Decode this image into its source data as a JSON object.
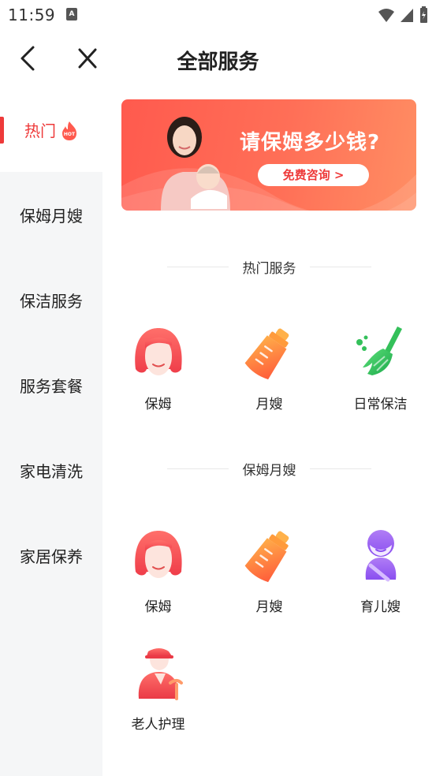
{
  "status_bar": {
    "time": "11:59",
    "notification_glyph": "A"
  },
  "header": {
    "title": "全部服务",
    "back_icon": "back-icon",
    "close_icon": "close-icon"
  },
  "sidebar": {
    "items": [
      {
        "label": "热门",
        "active": true,
        "badge": "HOT"
      },
      {
        "label": "保姆月嫂",
        "active": false
      },
      {
        "label": "保洁服务",
        "active": false
      },
      {
        "label": "服务套餐",
        "active": false
      },
      {
        "label": "家电清洗",
        "active": false
      },
      {
        "label": "家居保养",
        "active": false
      }
    ]
  },
  "banner": {
    "title": "请保姆多少钱?",
    "button_label": "免费咨询 >"
  },
  "sections": [
    {
      "title": "热门服务",
      "items": [
        {
          "label": "保姆",
          "icon": "nanny-icon"
        },
        {
          "label": "月嫂",
          "icon": "baby-bottle-icon"
        },
        {
          "label": "日常保洁",
          "icon": "broom-icon"
        }
      ]
    },
    {
      "title": "保姆月嫂",
      "items": [
        {
          "label": "保姆",
          "icon": "nanny-icon"
        },
        {
          "label": "月嫂",
          "icon": "baby-bottle-icon"
        },
        {
          "label": "育儿嫂",
          "icon": "childcare-icon"
        },
        {
          "label": "老人护理",
          "icon": "elderly-care-icon"
        }
      ]
    }
  ],
  "colors": {
    "accent": "#ee3a3a",
    "sidebar_bg": "#f5f6f7",
    "bottle_orange": "#ff7a3d",
    "broom_green": "#2fbf5a",
    "childcare_purple": "#9a5cf0"
  }
}
